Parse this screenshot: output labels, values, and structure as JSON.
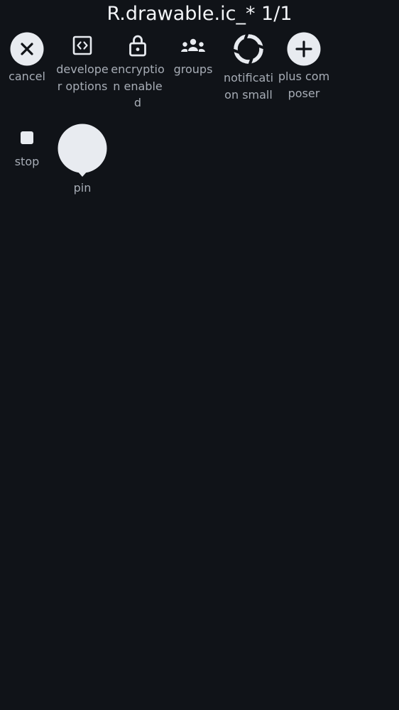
{
  "header": {
    "title": "R.drawable.ic_*  1/1"
  },
  "icons": [
    {
      "name": "cancel",
      "label": "cancel"
    },
    {
      "name": "developer-options",
      "label": "developer options"
    },
    {
      "name": "encryption-enabled",
      "label": "encryption enabled"
    },
    {
      "name": "groups",
      "label": "groups"
    },
    {
      "name": "notification-small",
      "label": "notification small"
    },
    {
      "name": "plus-composer",
      "label": "plus composer"
    },
    {
      "name": "stop",
      "label": "stop"
    },
    {
      "name": "pin",
      "label": "pin"
    }
  ],
  "colors": {
    "background": "#101318",
    "icon": "#e8ebf0",
    "label": "#a7adb6"
  }
}
